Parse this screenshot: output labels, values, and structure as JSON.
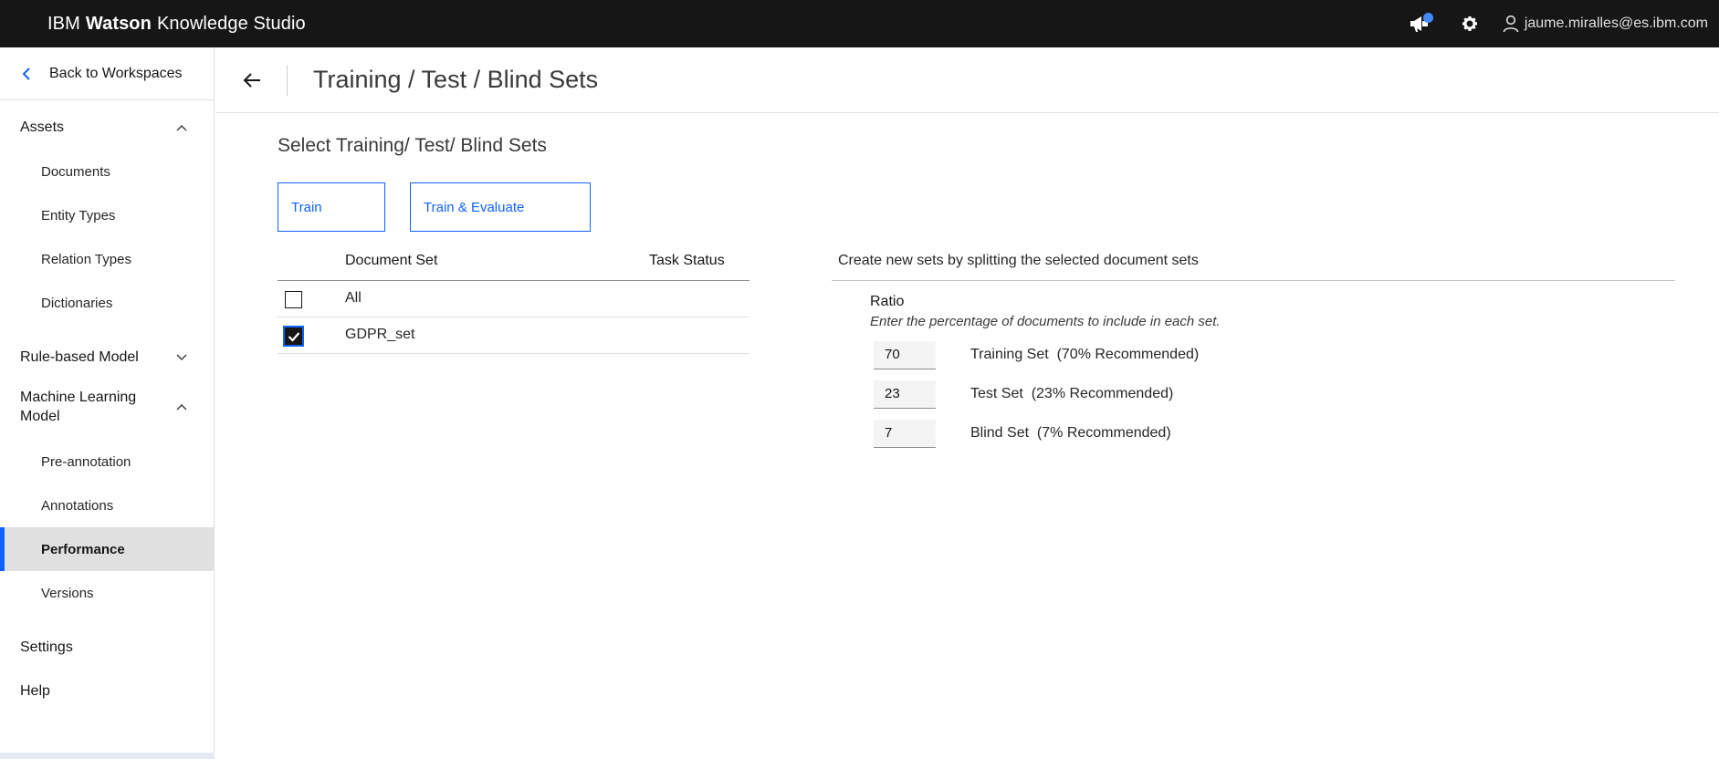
{
  "topbar": {
    "brand_prefix": "IBM",
    "brand_bold": "Watson",
    "brand_suffix": "Knowledge Studio",
    "user_email": "jaume.miralles@es.ibm.com"
  },
  "sidebar": {
    "back_label": "Back to Workspaces",
    "groups": [
      {
        "label": "Assets",
        "expanded": true,
        "items": [
          "Documents",
          "Entity Types",
          "Relation Types",
          "Dictionaries"
        ]
      },
      {
        "label": "Rule-based Model",
        "expanded": false,
        "items": []
      },
      {
        "label": "Machine Learning Model",
        "expanded": true,
        "items": [
          "Pre-annotation",
          "Annotations",
          "Performance",
          "Versions"
        ]
      }
    ],
    "active_item": "Performance",
    "settings_label": "Settings",
    "help_label": "Help"
  },
  "header": {
    "title": "Training / Test / Blind Sets"
  },
  "main": {
    "section_title": "Select Training/ Test/ Blind Sets",
    "buttons": {
      "train": "Train",
      "train_evaluate": "Train & Evaluate"
    },
    "table": {
      "col_document_set": "Document Set",
      "col_task_status": "Task Status",
      "rows": [
        {
          "name": "All",
          "checked": false,
          "status": ""
        },
        {
          "name": "GDPR_set",
          "checked": true,
          "status": ""
        }
      ]
    },
    "ratio": {
      "heading": "Create new sets by splitting the selected document sets",
      "label": "Ratio",
      "help": "Enter the percentage of documents to include in each set.",
      "sets": [
        {
          "value": "70",
          "label": "Training Set  (70% Recommended)"
        },
        {
          "value": "23",
          "label": "Test Set  (23% Recommended)"
        },
        {
          "value": "7",
          "label": "Blind Set  (7% Recommended)"
        }
      ]
    }
  },
  "colors": {
    "topbar_bg": "#161616",
    "accent": "#0f62fe",
    "notification_dot": "#4589ff",
    "active_nav_bg": "#e0e0e0"
  }
}
